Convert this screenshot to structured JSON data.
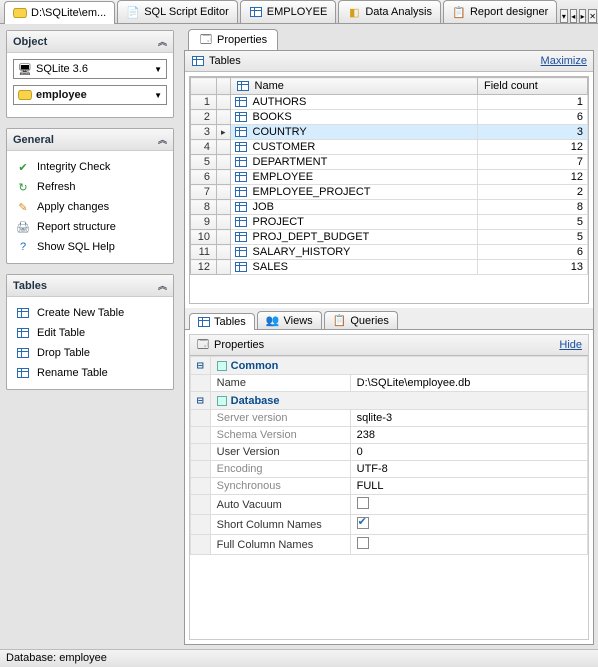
{
  "tabs": {
    "items": [
      {
        "label": "D:\\SQLite\\em...",
        "icon": "db",
        "active": true
      },
      {
        "label": "SQL Script Editor",
        "icon": "sql"
      },
      {
        "label": "EMPLOYEE",
        "icon": "table"
      },
      {
        "label": "Data Analysis",
        "icon": "cube"
      },
      {
        "label": "Report designer",
        "icon": "report"
      }
    ]
  },
  "sidebar": {
    "object": {
      "title": "Object",
      "engine": "SQLite 3.6",
      "database": "employee"
    },
    "general": {
      "title": "General",
      "items": [
        {
          "label": "Integrity Check",
          "icon": "✔",
          "color": "#2a9d3a"
        },
        {
          "label": "Refresh",
          "icon": "↻",
          "color": "#2a9d3a"
        },
        {
          "label": "Apply changes",
          "icon": "✎",
          "color": "#d08c20"
        },
        {
          "label": "Report structure",
          "icon": "🖨",
          "color": "#5b7185"
        },
        {
          "label": "Show SQL Help",
          "icon": "?",
          "color": "#1a6fc0"
        }
      ]
    },
    "tables": {
      "title": "Tables",
      "items": [
        {
          "label": "Create New Table",
          "icon": "▦"
        },
        {
          "label": "Edit Table",
          "icon": "▦"
        },
        {
          "label": "Drop Table",
          "icon": "▦"
        },
        {
          "label": "Rename Table",
          "icon": "▦"
        }
      ]
    }
  },
  "content": {
    "tab": "Properties",
    "tables_section": "Tables",
    "maximize": "Maximize",
    "columns": {
      "name": "Name",
      "count": "Field count"
    },
    "rows": [
      {
        "n": 1,
        "name": "AUTHORS",
        "count": 1
      },
      {
        "n": 2,
        "name": "BOOKS",
        "count": 6
      },
      {
        "n": 3,
        "name": "COUNTRY",
        "count": 3,
        "selected": true
      },
      {
        "n": 4,
        "name": "CUSTOMER",
        "count": 12
      },
      {
        "n": 5,
        "name": "DEPARTMENT",
        "count": 7
      },
      {
        "n": 6,
        "name": "EMPLOYEE",
        "count": 12
      },
      {
        "n": 7,
        "name": "EMPLOYEE_PROJECT",
        "count": 2
      },
      {
        "n": 8,
        "name": "JOB",
        "count": 8
      },
      {
        "n": 9,
        "name": "PROJECT",
        "count": 5
      },
      {
        "n": 10,
        "name": "PROJ_DEPT_BUDGET",
        "count": 5
      },
      {
        "n": 11,
        "name": "SALARY_HISTORY",
        "count": 6
      },
      {
        "n": 12,
        "name": "SALES",
        "count": 13
      }
    ],
    "subtabs": [
      {
        "label": "Tables",
        "active": true
      },
      {
        "label": "Views"
      },
      {
        "label": "Queries"
      }
    ],
    "properties": {
      "title": "Properties",
      "hide": "Hide",
      "groups": [
        {
          "name": "Common",
          "rows": [
            {
              "k": "Name",
              "v": "D:\\SQLite\\employee.db",
              "ro": false
            }
          ]
        },
        {
          "name": "Database",
          "rows": [
            {
              "k": "Server version",
              "v": "sqlite-3",
              "ro": true
            },
            {
              "k": "Schema Version",
              "v": "238",
              "ro": true
            },
            {
              "k": "User Version",
              "v": "0",
              "ro": false
            },
            {
              "k": "Encoding",
              "v": "UTF-8",
              "ro": true
            },
            {
              "k": "Synchronous",
              "v": "FULL",
              "ro": true
            },
            {
              "k": "Auto Vacuum",
              "v": "",
              "chk": false
            },
            {
              "k": "Short Column Names",
              "v": "",
              "chk": true
            },
            {
              "k": "Full Column Names",
              "v": "",
              "chk": false
            }
          ]
        }
      ]
    }
  },
  "statusbar": "Database: employee"
}
